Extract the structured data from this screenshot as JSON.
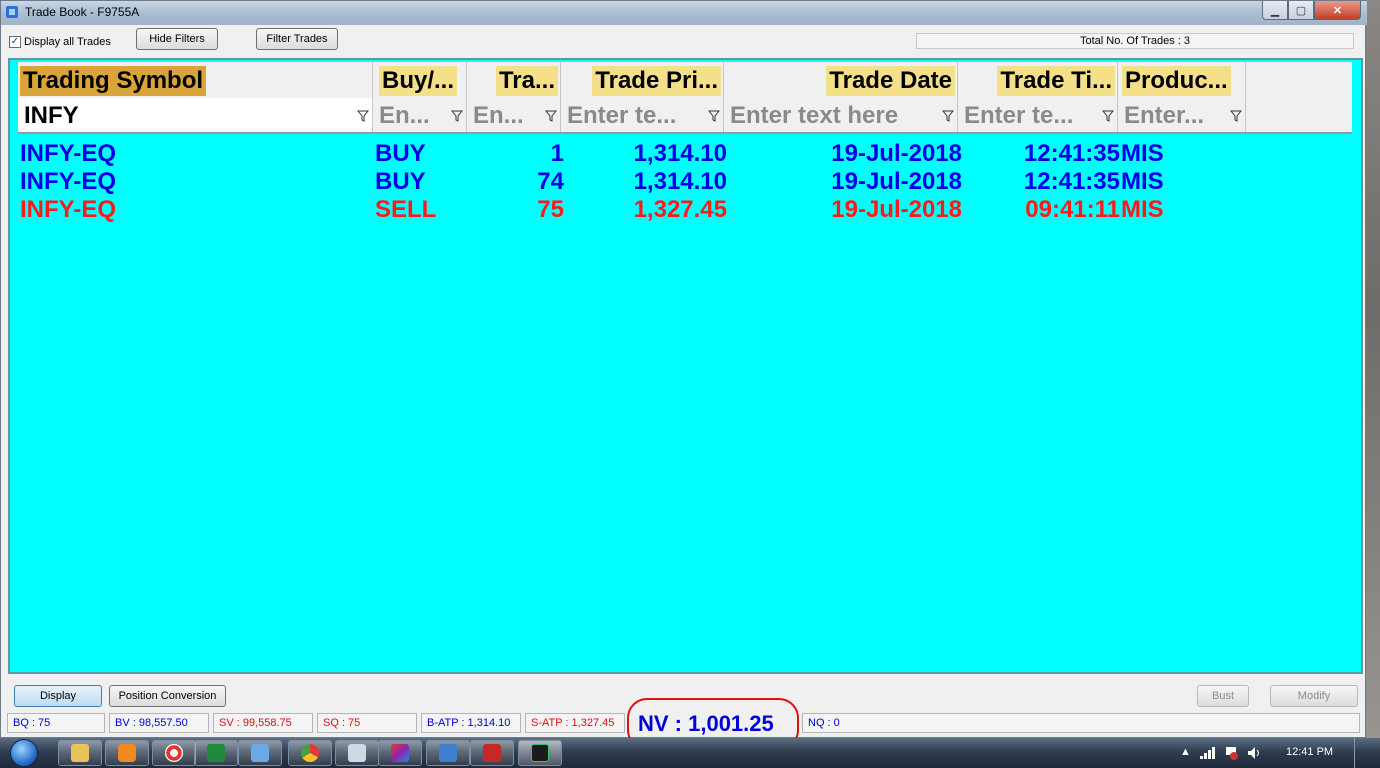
{
  "window": {
    "title": "Trade Book - F9755A",
    "min_glyph": "▁",
    "max_glyph": "▢",
    "close_glyph": "✕"
  },
  "toolbar": {
    "display_all_label": "Display all Trades",
    "display_all_checked": true,
    "check_glyph": "✓",
    "hide_filters_label": "Hide Filters",
    "filter_trades_label": "Filter Trades",
    "total_trades_text": "Total No. Of Trades : 3"
  },
  "grid": {
    "columns": [
      {
        "label": "Trading Symbol"
      },
      {
        "label": "Buy/..."
      },
      {
        "label": "Tra..."
      },
      {
        "label": "Trade Pri..."
      },
      {
        "label": "Trade Date"
      },
      {
        "label": "Trade Ti..."
      },
      {
        "label": "Produc..."
      }
    ],
    "filters": [
      {
        "value": "INFY"
      },
      {
        "value": "En..."
      },
      {
        "value": "En..."
      },
      {
        "value": "Enter te..."
      },
      {
        "value": "Enter text here"
      },
      {
        "value": "Enter te..."
      },
      {
        "value": "Enter..."
      }
    ],
    "rows": [
      {
        "symbol": "INFY-EQ",
        "side": "BUY",
        "qty": "1",
        "price": "1,314.10",
        "date": "19-Jul-2018",
        "time": "12:41:35",
        "product": "MIS"
      },
      {
        "symbol": "INFY-EQ",
        "side": "BUY",
        "qty": "74",
        "price": "1,314.10",
        "date": "19-Jul-2018",
        "time": "12:41:35",
        "product": "MIS"
      },
      {
        "symbol": "INFY-EQ",
        "side": "SELL",
        "qty": "75",
        "price": "1,327.45",
        "date": "19-Jul-2018",
        "time": "09:41:11",
        "product": "MIS"
      }
    ],
    "bg_color": "#00ffff",
    "buy_color": "#0000e6",
    "sell_color": "#ff1a1a"
  },
  "bottom": {
    "display_label": "Display",
    "position_conversion_label": "Position Conversion",
    "bust_label": "Bust",
    "modify_label": "Modify"
  },
  "status": {
    "bq": "BQ : 75",
    "bv": "BV : 98,557.50",
    "sv": "SV : 99,558.75",
    "sq": "SQ : 75",
    "batp": "B-ATP : 1,314.10",
    "satp": "S-ATP : 1,327.45",
    "nv": "NV : 1,001.25",
    "nq": "NQ : 0"
  },
  "taskbar": {
    "clock": "12:41 PM",
    "apps": [
      "explorer",
      "media-player",
      "lifebuoy",
      "excel",
      "window",
      "chrome",
      "calculator",
      "paint-app",
      "folder-app",
      "pdf-reader",
      "chart-app"
    ]
  }
}
